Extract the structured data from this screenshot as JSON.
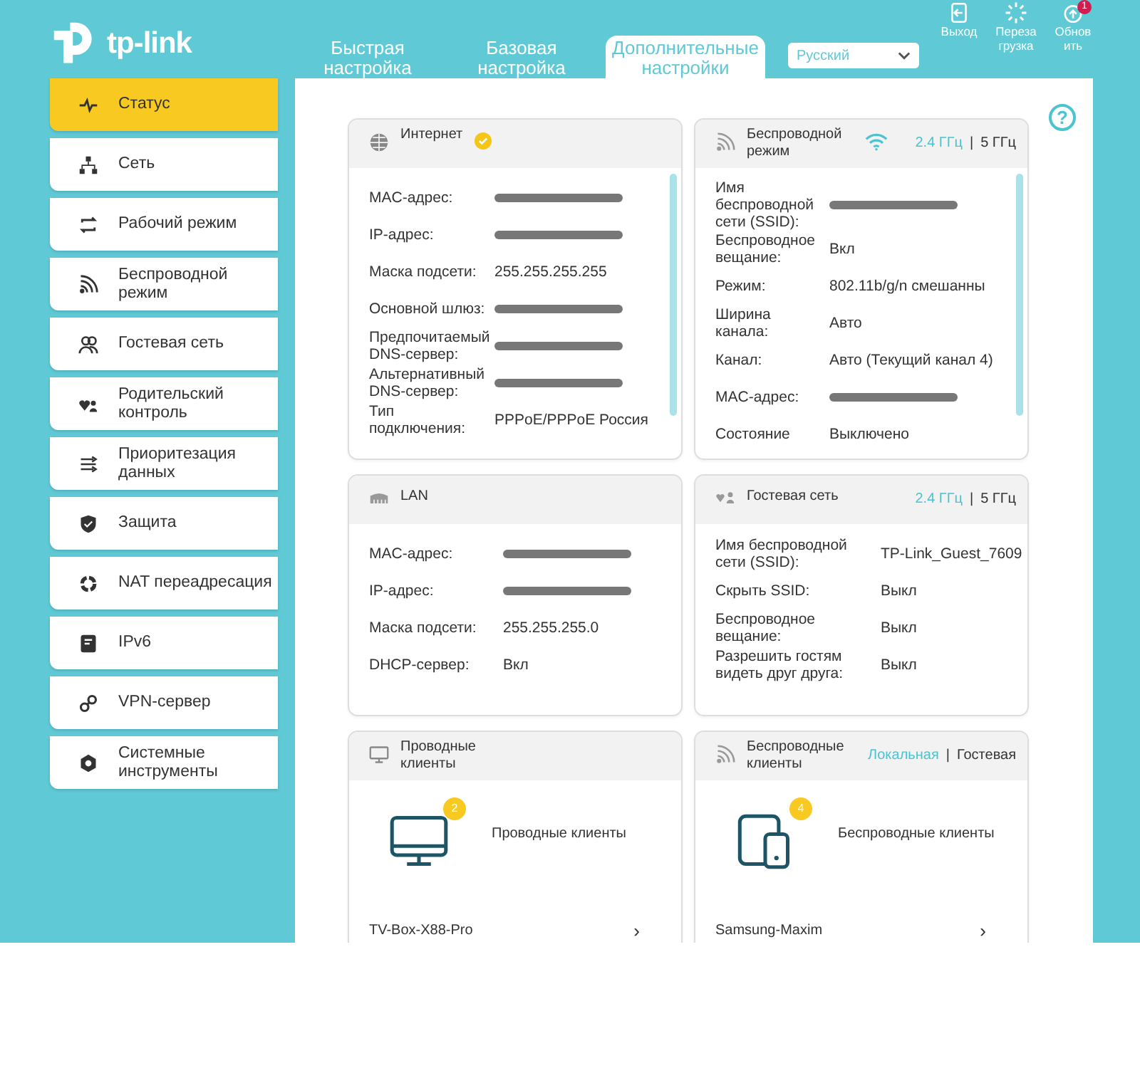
{
  "logo": {
    "text": "tp-link"
  },
  "tabs": [
    {
      "label": "Быстрая настройка",
      "selected": false
    },
    {
      "label": "Базовая настройка",
      "selected": false
    },
    {
      "label": "Дополнительные настройки",
      "selected": true
    }
  ],
  "language": {
    "value": "Русский"
  },
  "actions": [
    {
      "label": "Выход"
    },
    {
      "label": "Перезагрузка"
    },
    {
      "label": "Обновить",
      "badge": "1"
    }
  ],
  "sidebar": {
    "items": [
      {
        "label": "Статус",
        "selected": true
      },
      {
        "label": "Сеть",
        "selected": false
      },
      {
        "label": "Рабочий режим",
        "selected": false
      },
      {
        "label": "Беспроводной режим",
        "selected": false
      },
      {
        "label": "Гостевая сеть",
        "selected": false
      },
      {
        "label": "Родительский контроль",
        "selected": false
      },
      {
        "label": "Приоритезация данных",
        "selected": false
      },
      {
        "label": "Защита",
        "selected": false
      },
      {
        "label": "NAT переадресация",
        "selected": false
      },
      {
        "label": "IPv6",
        "selected": false
      },
      {
        "label": "VPN-сервер",
        "selected": false
      },
      {
        "label": "Системные инструменты",
        "selected": false
      }
    ]
  },
  "help": {
    "text": "?"
  },
  "cards": [
    {
      "kind": "info",
      "title": "Интернет",
      "connected": true,
      "scrollbar": true,
      "rows": [
        {
          "label": "MAC-адрес:",
          "redacted": true
        },
        {
          "label": "IP-адрес:",
          "redacted": true
        },
        {
          "label": "Маска подсети:",
          "value": "255.255.255.255",
          "redacted": false
        },
        {
          "label": "Основной шлюз:",
          "redacted": true
        },
        {
          "label": "Предпочитаемый DNS-сервер:",
          "redacted": true
        },
        {
          "label": "Альтернативный DNS-сервер:",
          "redacted": true
        },
        {
          "label": "Тип подключения:",
          "value": "PPPoE/PPPoE Россия",
          "redacted": false
        }
      ]
    },
    {
      "kind": "info",
      "title": "Беспроводной режим",
      "wifi_on": true,
      "scrollbar": true,
      "separator": "|",
      "bands": [
        {
          "label": "2.4 ГГц",
          "selected": true
        },
        {
          "label": "5 ГГц",
          "selected": false
        }
      ],
      "rows": [
        {
          "label": "Имя беспроводной сети (SSID):",
          "redacted": true
        },
        {
          "label": "Беспроводное вещание:",
          "value": "Вкл",
          "redacted": false
        },
        {
          "label": "Режим:",
          "value": "802.11b/g/n смешанны",
          "redacted": false
        },
        {
          "label": "Ширина канала:",
          "value": "Авто",
          "redacted": false
        },
        {
          "label": "Канал:",
          "value": "Авто (Текущий канал 4)",
          "redacted": false
        },
        {
          "label": "MAC-адрес:",
          "redacted": true
        },
        {
          "label": "Состояние",
          "value": "Выключено",
          "redacted": false
        }
      ]
    },
    {
      "kind": "info",
      "title": "LAN",
      "rows": [
        {
          "label": "MAC-адрес:",
          "redacted": true
        },
        {
          "label": "IP-адрес:",
          "redacted": true
        },
        {
          "label": "Маска подсети:",
          "value": "255.255.255.0",
          "redacted": false
        },
        {
          "label": "DHCP-сервер:",
          "value": "Вкл",
          "redacted": false
        }
      ]
    },
    {
      "kind": "info",
      "title": "Гостевая сеть",
      "separator": "|",
      "bands": [
        {
          "label": "2.4 ГГц",
          "selected": true
        },
        {
          "label": "5 ГГц",
          "selected": false
        }
      ],
      "rows": [
        {
          "label": "Имя беспроводной сети (SSID):",
          "value": "TP-Link_Guest_7609",
          "redacted": false
        },
        {
          "label": "Скрыть SSID:",
          "value": "Выкл",
          "redacted": false
        },
        {
          "label": "Беспроводное вещание:",
          "value": "Выкл",
          "redacted": false
        },
        {
          "label": "Разрешить гостям видеть друг друга:",
          "value": "Выкл",
          "redacted": false
        }
      ]
    },
    {
      "kind": "clients",
      "title": "Проводные клиенты",
      "count": "2",
      "caption": "Проводные клиенты",
      "items": [
        {
          "name": "TV-Box-X88-Pro",
          "arrow": "›"
        }
      ]
    },
    {
      "kind": "clients",
      "title": "Беспроводные клиенты",
      "separator": "|",
      "bands": [
        {
          "label": "Локальная",
          "selected": true
        },
        {
          "label": "Гостевая",
          "selected": false
        }
      ],
      "count": "4",
      "caption": "Беспроводные клиенты",
      "items": [
        {
          "name": "Samsung-Maxim",
          "arrow": "›"
        }
      ]
    }
  ]
}
